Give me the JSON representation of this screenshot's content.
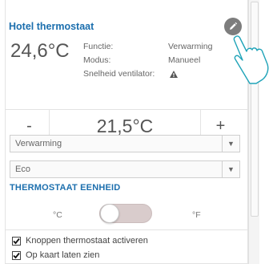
{
  "header": {
    "title": "Hotel thermostaat"
  },
  "status": {
    "current_temperature": "24,6°C",
    "labels": {
      "function": "Functie:",
      "mode": "Modus:",
      "fan_speed": "Snelheid ventilator:"
    },
    "values": {
      "function": "Verwarming",
      "mode": "Manueel",
      "fan_speed_icon": "warning-triangle-icon"
    }
  },
  "setpoint": {
    "minus_label": "-",
    "value": "21,5°C",
    "plus_label": "+"
  },
  "selects": {
    "function": {
      "value": "Verwarming"
    },
    "mode": {
      "value": "Eco"
    }
  },
  "unit_section": {
    "title": "THERMOSTAAT EENHEID",
    "left_label": "°C",
    "right_label": "°F"
  },
  "checkboxes": [
    {
      "label": "Knoppen thermostaat activeren",
      "checked": true
    },
    {
      "label": "Op kaart laten zien",
      "checked": true
    }
  ],
  "colors": {
    "accent": "#1c6fae",
    "toggle_track": "#d9cccc",
    "edit_button": "#7d7d7d"
  }
}
